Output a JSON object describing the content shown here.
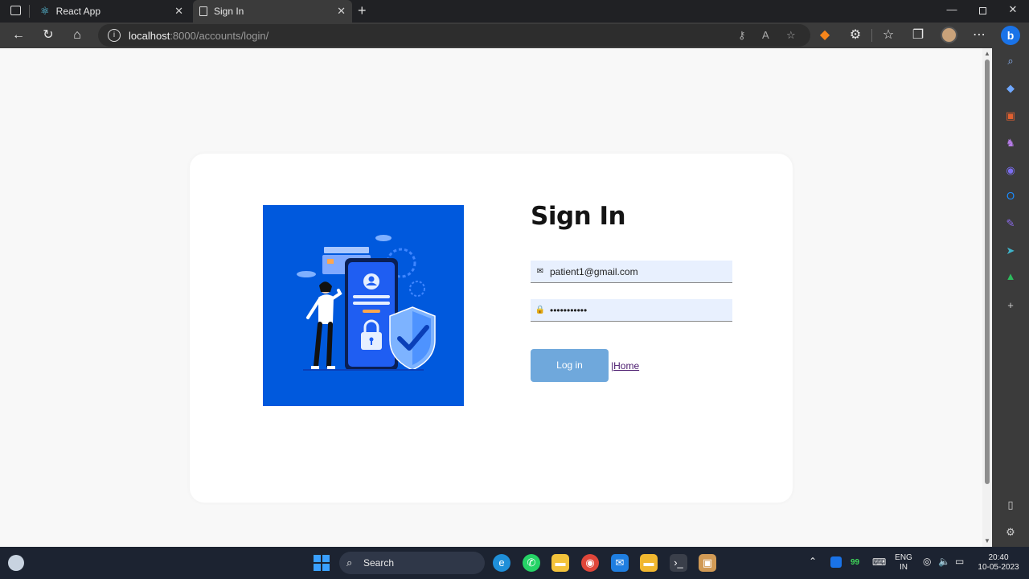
{
  "browser": {
    "tabs": [
      {
        "label": "React App",
        "icon": "react-icon"
      },
      {
        "label": "Sign In",
        "icon": "page-icon",
        "active": true
      }
    ],
    "address": {
      "host": "localhost",
      "rest": ":8000/accounts/login/"
    }
  },
  "page": {
    "title": "Sign In",
    "email": {
      "value": "patient1@gmail.com",
      "icon": "envelope-icon"
    },
    "password": {
      "value": "•••••••••••",
      "icon": "lock-icon"
    },
    "login_label": "Log in",
    "home_prefix": "|",
    "home_label": "Home"
  },
  "taskbar": {
    "search_label": "Search",
    "badge": "99",
    "lang_top": "ENG",
    "lang_bottom": "IN",
    "time": "20:40",
    "date": "10-05-2023"
  },
  "colors": {
    "accent": "#0059dd",
    "button": "#6fa8dc",
    "chrome": "#3b3b3b"
  }
}
